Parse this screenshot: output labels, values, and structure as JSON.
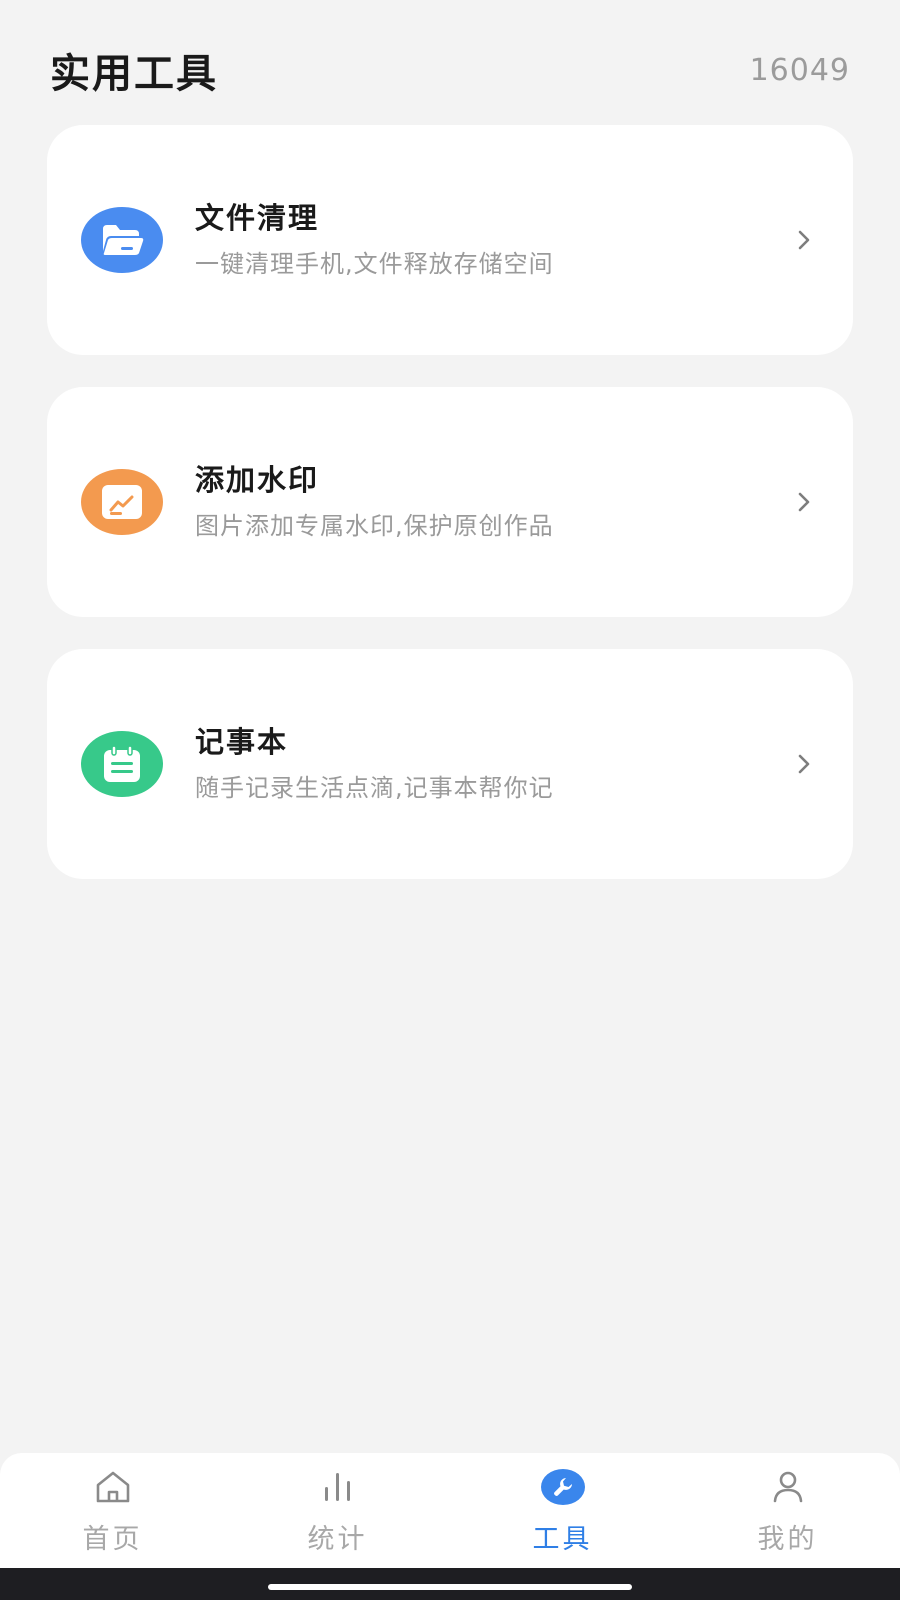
{
  "header": {
    "title": "实用工具",
    "counter": "16049"
  },
  "tools": [
    {
      "title": "文件清理",
      "description": "一键清理手机,文件释放存储空间",
      "icon": "folder-icon",
      "color": "#4a8cf0"
    },
    {
      "title": "添加水印",
      "description": "图片添加专属水印,保护原创作品",
      "icon": "image-icon",
      "color": "#f39a4f"
    },
    {
      "title": "记事本",
      "description": "随手记录生活点滴,记事本帮你记",
      "icon": "notepad-icon",
      "color": "#37c98a"
    }
  ],
  "bottom_nav": {
    "items": [
      {
        "label": "首页",
        "icon": "home-icon",
        "active": false
      },
      {
        "label": "统计",
        "icon": "bar-chart-icon",
        "active": false
      },
      {
        "label": "工具",
        "icon": "wrench-icon",
        "active": true
      },
      {
        "label": "我的",
        "icon": "user-icon",
        "active": false
      }
    ],
    "active_color": "#2f7fe6",
    "inactive_color": "#a8a8a8"
  }
}
